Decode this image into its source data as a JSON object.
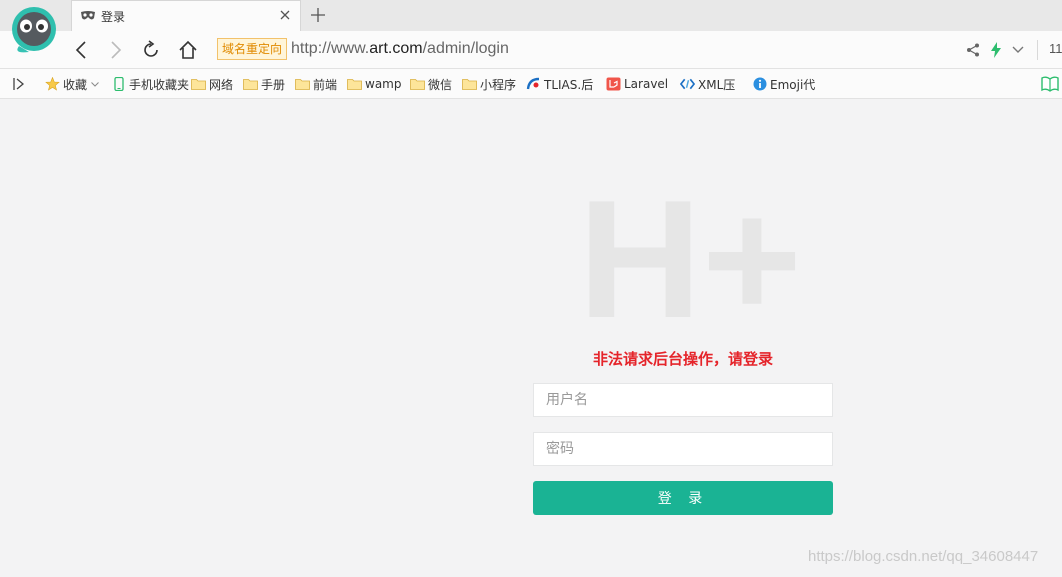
{
  "browser": {
    "tab": {
      "title": "登录"
    },
    "address": {
      "redirect_badge": "域名重定向",
      "url_prefix": "http://www.",
      "url_host": "art.com",
      "url_path": "/admin/login"
    },
    "toolbar_cutoff_text": "11"
  },
  "bookmarks": {
    "items": [
      {
        "label": "收藏",
        "icon": "star-icon"
      },
      {
        "label": "手机收藏夹",
        "icon": "phone-icon"
      },
      {
        "label": "网络",
        "icon": "folder-icon"
      },
      {
        "label": "手册",
        "icon": "folder-icon"
      },
      {
        "label": "前端",
        "icon": "folder-icon"
      },
      {
        "label": "wamp",
        "icon": "folder-icon"
      },
      {
        "label": "微信",
        "icon": "folder-icon"
      },
      {
        "label": "小程序",
        "icon": "folder-icon"
      },
      {
        "label": "TLIAS.后",
        "icon": "tlias-icon"
      },
      {
        "label": "Laravel",
        "icon": "laravel-icon"
      },
      {
        "label": "XML压",
        "icon": "code-icon"
      },
      {
        "label": "Emoji代",
        "icon": "info-icon"
      }
    ]
  },
  "login": {
    "logo_text": "H+",
    "error_message": "非法请求后台操作，请登录",
    "username_placeholder": "用户名",
    "password_placeholder": "密码",
    "submit_label": "登 录"
  },
  "watermark": "https://blog.csdn.net/qq_34608447",
  "colors": {
    "accent": "#1ab394",
    "error": "#e5242a",
    "page_bg": "#f3f3f4",
    "logo_gray": "#e6e6e6"
  }
}
